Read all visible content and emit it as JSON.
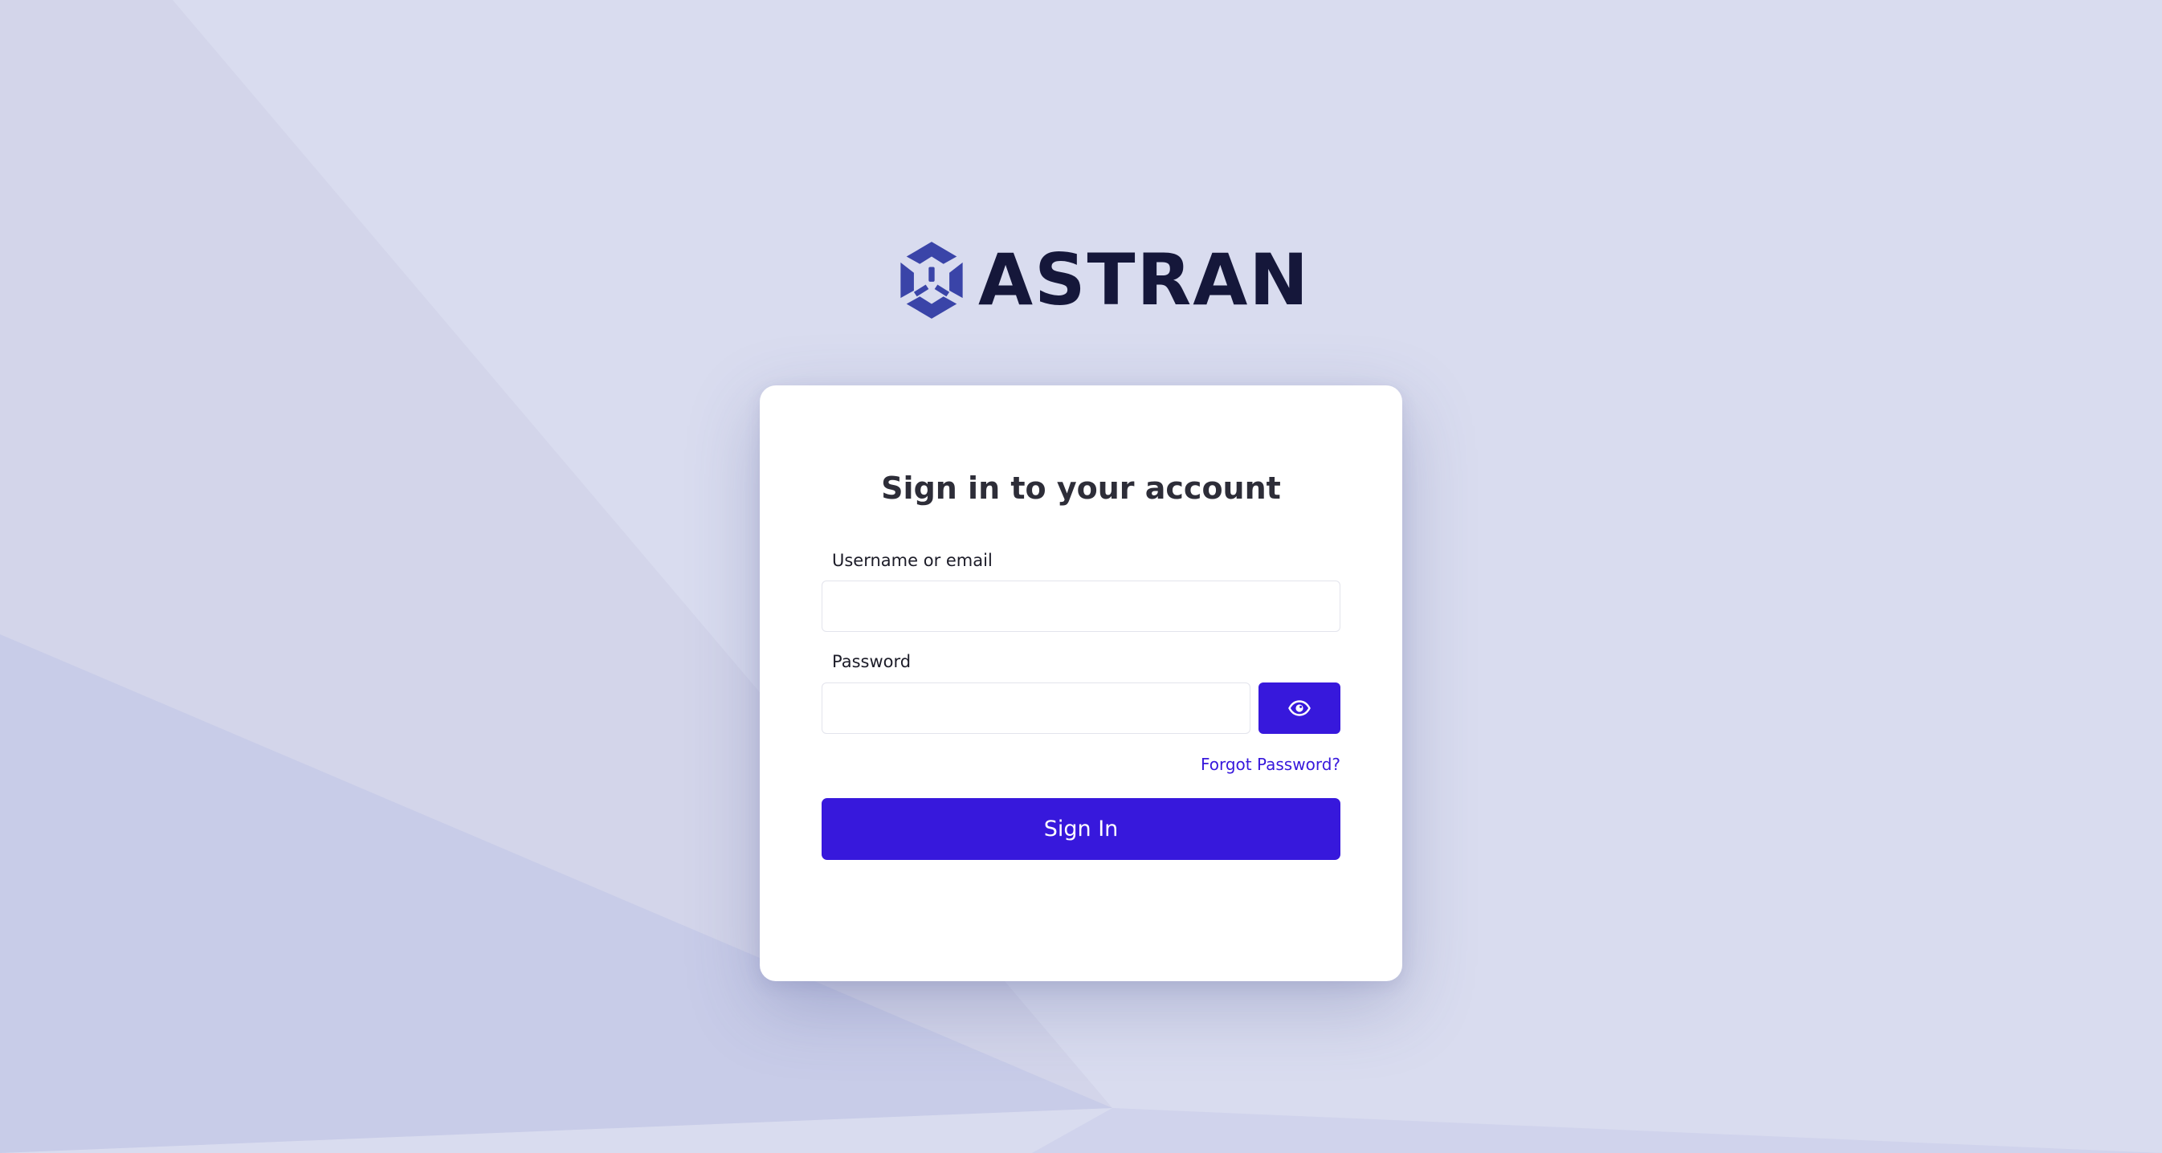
{
  "brand": {
    "name": "ASTRAN",
    "logo_icon": "hexagon-cube-logo-icon",
    "color": "#3a44a8"
  },
  "login": {
    "title": "Sign in to your account",
    "username_label": "Username or email",
    "username_value": "",
    "password_label": "Password",
    "password_value": "",
    "show_password_icon": "eye-icon",
    "forgot_password": "Forgot Password?",
    "submit": "Sign In"
  },
  "colors": {
    "background": "#d9dcef",
    "accent": "#3718dc",
    "title_text": "#2d2d38",
    "card": "#ffffff"
  }
}
